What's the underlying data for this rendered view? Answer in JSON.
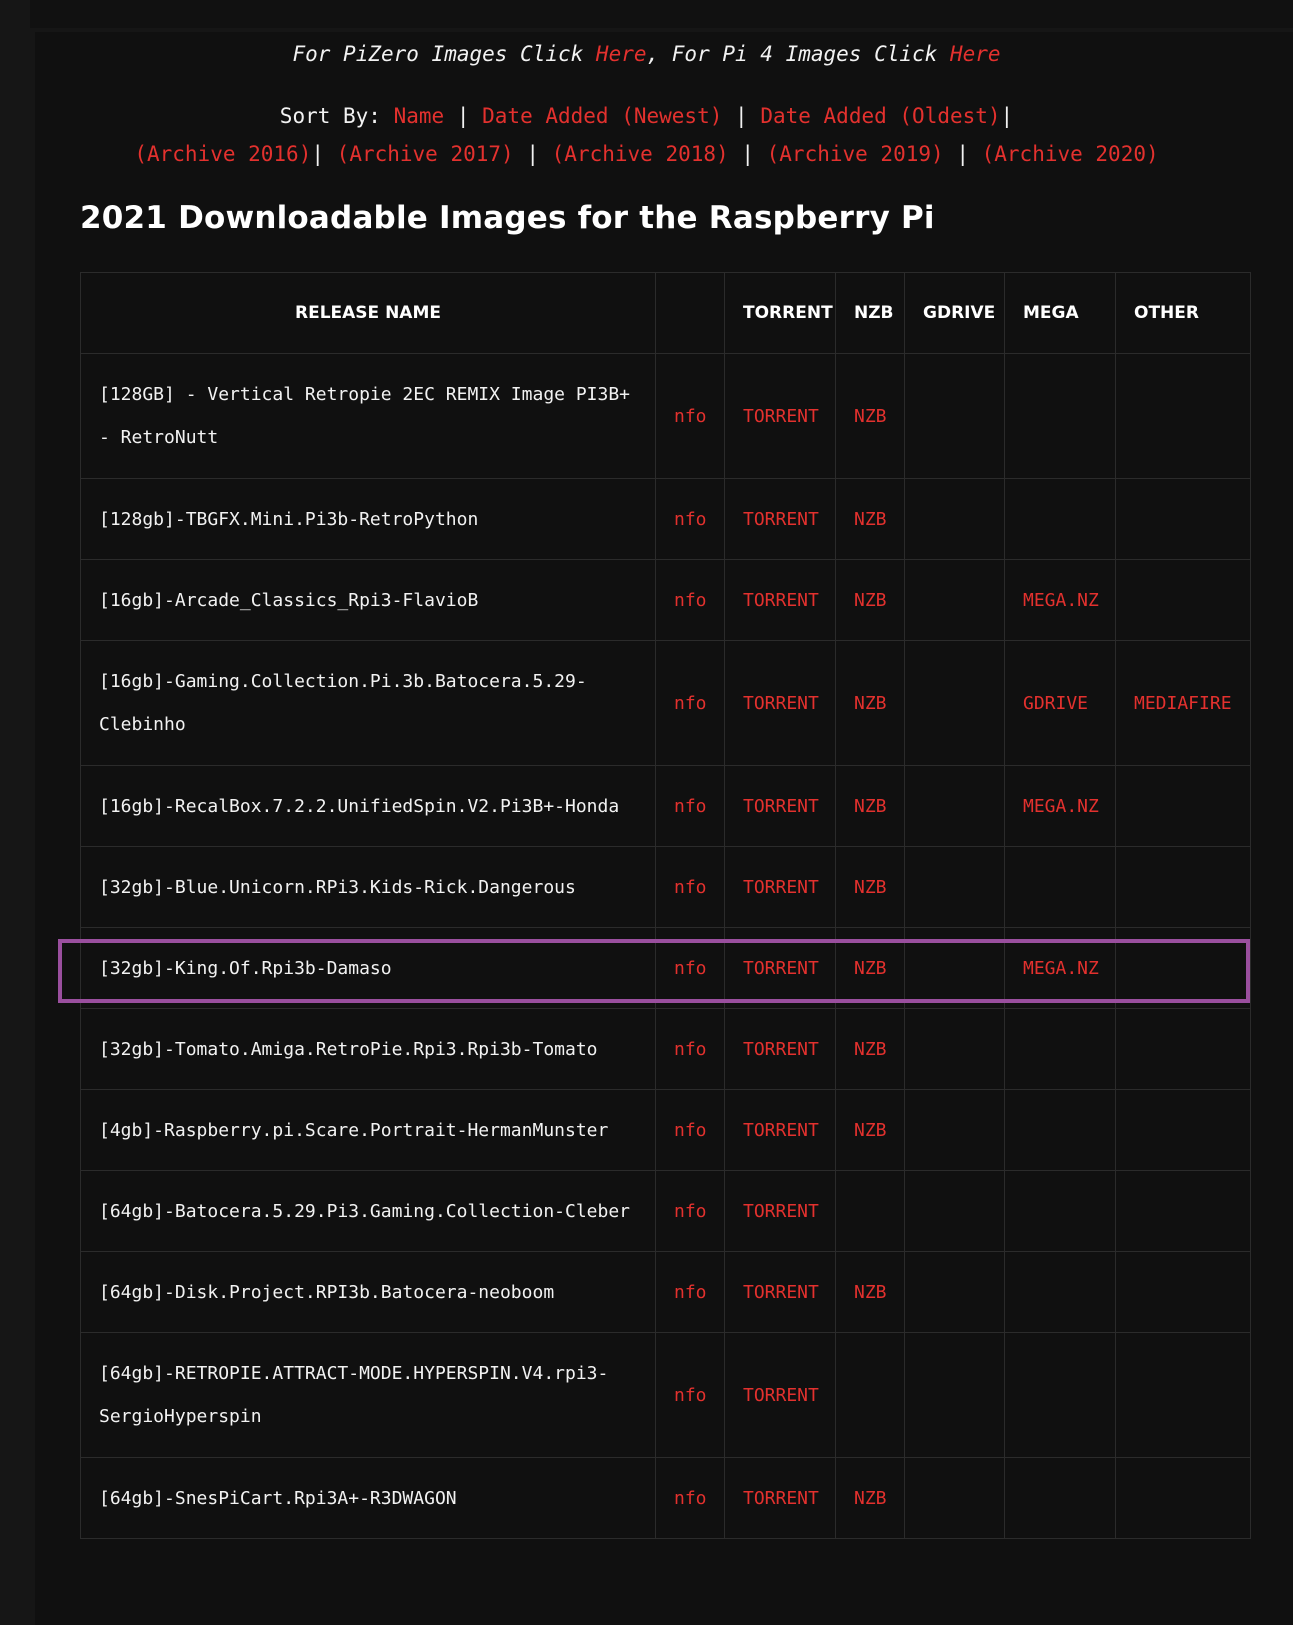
{
  "nav": {
    "pizero_text": "For PiZero Images Click ",
    "pizero_link": "Here",
    "pi4_text": ", For Pi 4 Images Click ",
    "pi4_link": "Here"
  },
  "sort": {
    "label": "Sort By: ",
    "name": "Name",
    "newest": "Date Added (Newest)",
    "oldest": "Date Added (Oldest)",
    "separator": "|",
    "archives": [
      "(Archive 2016)",
      "(Archive 2017)",
      "(Archive 2018)",
      "(Archive 2019)",
      "(Archive 2020)"
    ]
  },
  "heading": "2021 Downloadable Images for the Raspberry Pi",
  "table": {
    "headers": [
      "RELEASE NAME",
      "",
      "TORRENT",
      "NZB",
      "GDRIVE",
      "MEGA",
      "OTHER"
    ],
    "rows": [
      {
        "name": "[128GB] - Vertical Retropie 2EC REMIX Image PI3B+ - RetroNutt",
        "nfo": "nfo",
        "torrent": "TORRENT",
        "nzb": "NZB",
        "gdrive": "",
        "mega": "",
        "other": ""
      },
      {
        "name": "[128gb]-TBGFX.Mini.Pi3b-RetroPython",
        "nfo": "nfo",
        "torrent": "TORRENT",
        "nzb": "NZB",
        "gdrive": "",
        "mega": "",
        "other": ""
      },
      {
        "name": "[16gb]-Arcade_Classics_Rpi3-FlavioB",
        "nfo": "nfo",
        "torrent": "TORRENT",
        "nzb": "NZB",
        "gdrive": "",
        "mega": "MEGA.NZ",
        "other": ""
      },
      {
        "name": "[16gb]-Gaming.Collection.Pi.3b.Batocera.5.29-Clebinho",
        "nfo": "nfo",
        "torrent": "TORRENT",
        "nzb": "NZB",
        "gdrive": "",
        "mega": "GDRIVE",
        "other": "MEDIAFIRE"
      },
      {
        "name": "[16gb]-RecalBox.7.2.2.UnifiedSpin.V2.Pi3B+-Honda",
        "nfo": "nfo",
        "torrent": "TORRENT",
        "nzb": "NZB",
        "gdrive": "",
        "mega": "MEGA.NZ",
        "other": ""
      },
      {
        "name": "[32gb]-Blue.Unicorn.RPi3.Kids-Rick.Dangerous",
        "nfo": "nfo",
        "torrent": "TORRENT",
        "nzb": "NZB",
        "gdrive": "",
        "mega": "",
        "other": ""
      },
      {
        "name": "[32gb]-King.Of.Rpi3b-Damaso",
        "nfo": "nfo",
        "torrent": "TORRENT",
        "nzb": "NZB",
        "gdrive": "",
        "mega": "MEGA.NZ",
        "other": ""
      },
      {
        "name": "[32gb]-Tomato.Amiga.RetroPie.Rpi3.Rpi3b-Tomato",
        "nfo": "nfo",
        "torrent": "TORRENT",
        "nzb": "NZB",
        "gdrive": "",
        "mega": "",
        "other": ""
      },
      {
        "name": "[4gb]-Raspberry.pi.Scare.Portrait-HermanMunster",
        "nfo": "nfo",
        "torrent": "TORRENT",
        "nzb": "NZB",
        "gdrive": "",
        "mega": "",
        "other": ""
      },
      {
        "name": "[64gb]-Batocera.5.29.Pi3.Gaming.Collection-Cleber",
        "nfo": "nfo",
        "torrent": "TORRENT",
        "nzb": "",
        "gdrive": "",
        "mega": "",
        "other": ""
      },
      {
        "name": "[64gb]-Disk.Project.RPI3b.Batocera-neoboom",
        "nfo": "nfo",
        "torrent": "TORRENT",
        "nzb": "NZB",
        "gdrive": "",
        "mega": "",
        "other": ""
      },
      {
        "name": "[64gb]-RETROPIE.ATTRACT-MODE.HYPERSPIN.V4.rpi3-SergioHyperspin",
        "nfo": "nfo",
        "torrent": "TORRENT",
        "nzb": "",
        "gdrive": "",
        "mega": "",
        "other": ""
      },
      {
        "name": "[64gb]-SnesPiCart.Rpi3A+-R3DWAGON",
        "nfo": "nfo",
        "torrent": "TORRENT",
        "nzb": "NZB",
        "gdrive": "",
        "mega": "",
        "other": ""
      }
    ]
  }
}
